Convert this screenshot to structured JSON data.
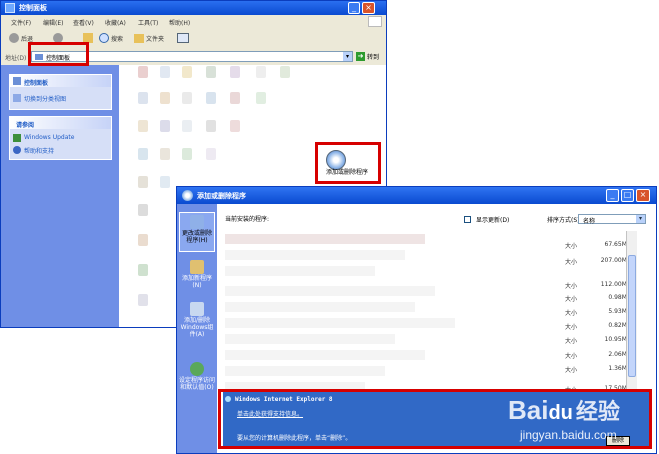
{
  "control_panel": {
    "title": "控制面板",
    "menu": [
      "文件(F)",
      "编辑(E)",
      "查看(V)",
      "收藏(A)",
      "工具(T)",
      "帮助(H)"
    ],
    "toolbar": {
      "back": "后退",
      "search": "搜索",
      "folders": "文件夹"
    },
    "address": {
      "label": "地址(D)",
      "value": "控制面板",
      "go": "转到"
    },
    "task_pane": {
      "panel_title": "控制面板",
      "switch_view": "切换到分类视图",
      "see_also_title": "请参阅",
      "windows_update": "Windows Update",
      "help_support": "帮助和支持"
    },
    "add_remove_icon_label": "添加或删除程序"
  },
  "add_remove": {
    "title": "添加或删除程序",
    "sidebar": [
      {
        "label": "更改或删除程序(H)",
        "icon": "change-remove-icon"
      },
      {
        "label": "添加新程序(N)",
        "icon": "add-program-icon"
      },
      {
        "label": "添加/删除Windows组件(A)",
        "icon": "windows-components-icon"
      },
      {
        "label": "设定程序访问和默认值(O)",
        "icon": "default-programs-icon"
      }
    ],
    "header_label": "当前安装的程序:",
    "show_updates": "显示更新(D)",
    "sort_by_label": "排序方式(S):",
    "sort_by_value": "名称",
    "sizes": [
      {
        "label": "大小",
        "value": "67.65MB"
      },
      {
        "label": "大小",
        "value": "207.00MB"
      },
      {
        "label": "大小",
        "value": "112.00MB"
      },
      {
        "label": "大小",
        "value": "0.98MB"
      },
      {
        "label": "大小",
        "value": "5.93MB"
      },
      {
        "label": "大小",
        "value": "0.82MB"
      },
      {
        "label": "大小",
        "value": "10.95MB"
      },
      {
        "label": "大小",
        "value": "2.06MB"
      },
      {
        "label": "大小",
        "value": "1.36MB"
      },
      {
        "label": "大小",
        "value": "17.50MB"
      }
    ],
    "selected": {
      "name": "Windows Internet Explorer 8",
      "support": "单击此处获得支持信息。",
      "hint": "要从您的计算机删除此程序，单击“删除”。",
      "remove_button": "删除"
    }
  },
  "watermark": {
    "brand": "Bai",
    "brand2": "du",
    "jingyan": "经验",
    "url": "jingyan.baidu.com"
  }
}
